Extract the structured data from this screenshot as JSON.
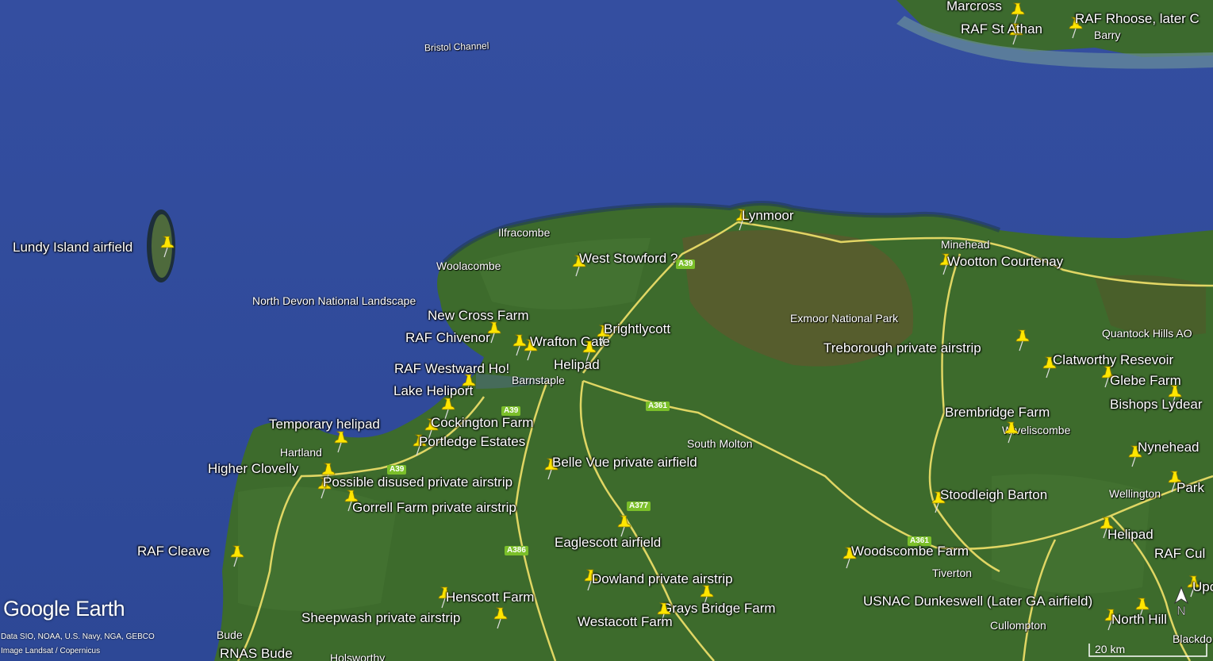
{
  "app": {
    "logo_text": "Google Earth"
  },
  "attribution": {
    "line1": "Data SIO, NOAA, U.S. Navy, NGA, GEBCO",
    "line2": "Image Landsat / Copernicus"
  },
  "scale_bar": {
    "label": "20 km"
  },
  "compass": {
    "letter": "N",
    "icon": "north-arrow-icon"
  },
  "pin_color": "#ffe600",
  "colors": {
    "sea": "#2f4a9a",
    "land": "#3d6b2c",
    "moor": "#5a5a2e",
    "road": "#f2e26a"
  },
  "placemarks": [
    {
      "label": "Marcross"
    },
    {
      "label": "RAF St Athan"
    },
    {
      "label": "RAF Rhoose, later C"
    },
    {
      "label": "Lundy Island airfield"
    },
    {
      "label": "Lynmoor"
    },
    {
      "label": "West Stowford ?"
    },
    {
      "label": "Wootton Courtenay"
    },
    {
      "label": "New Cross Farm"
    },
    {
      "label": "RAF Chivenor"
    },
    {
      "label": "Wrafton Gate"
    },
    {
      "label": "Brightlycott"
    },
    {
      "label": "Helipad"
    },
    {
      "label": "Treborough private airstrip"
    },
    {
      "label": "Clatworthy Resevoir"
    },
    {
      "label": "Glebe Farm"
    },
    {
      "label": "RAF Westward Ho!"
    },
    {
      "label": "Lake Heliport"
    },
    {
      "label": "Bishops Lydear"
    },
    {
      "label": "Cockington Farm"
    },
    {
      "label": "Temporary helipad"
    },
    {
      "label": "Brembridge Farm"
    },
    {
      "label": "Portledge Estates"
    },
    {
      "label": "Nynehead"
    },
    {
      "label": "Belle Vue private airfield"
    },
    {
      "label": "Higher Clovelly"
    },
    {
      "label": "Possible disused private airstrip"
    },
    {
      "label": "Park"
    },
    {
      "label": "Stoodleigh Barton"
    },
    {
      "label": "Gorrell Farm private airstrip"
    },
    {
      "label": "Helipad"
    },
    {
      "label": "Eaglescott airfield"
    },
    {
      "label": "RAF Cleave"
    },
    {
      "label": "Woodscombe Farm"
    },
    {
      "label": "RAF Cul"
    },
    {
      "label": "Dowland private airstrip"
    },
    {
      "label": "Upo"
    },
    {
      "label": "Henscott Farm"
    },
    {
      "label": "USNAC Dunkeswell (Later GA airfield)"
    },
    {
      "label": "Grays Bridge Farm"
    },
    {
      "label": "Sheepwash private airstrip"
    },
    {
      "label": "Westacott Farm"
    },
    {
      "label": "North Hill"
    },
    {
      "label": "RNAS Bude"
    }
  ],
  "place_names": [
    {
      "label": "Bristol Channel"
    },
    {
      "label": "Barry"
    },
    {
      "label": "Ilfracombe"
    },
    {
      "label": "Woolacombe"
    },
    {
      "label": "Minehead"
    },
    {
      "label": "North Devon National Landscape"
    },
    {
      "label": "Exmoor National Park"
    },
    {
      "label": "Quantock Hills AO"
    },
    {
      "label": "Barnstaple"
    },
    {
      "label": "South Molton"
    },
    {
      "label": "Wiveliscombe"
    },
    {
      "label": "Hartland"
    },
    {
      "label": "Wellington"
    },
    {
      "label": "Tiverton"
    },
    {
      "label": "Cullompton"
    },
    {
      "label": "Bude"
    },
    {
      "label": "Holsworthy"
    },
    {
      "label": "Blackdo"
    }
  ],
  "road_shields": [
    {
      "label": "A39"
    },
    {
      "label": "A39"
    },
    {
      "label": "A361"
    },
    {
      "label": "A377"
    },
    {
      "label": "A386"
    },
    {
      "label": "A361"
    },
    {
      "label": "A39"
    }
  ]
}
